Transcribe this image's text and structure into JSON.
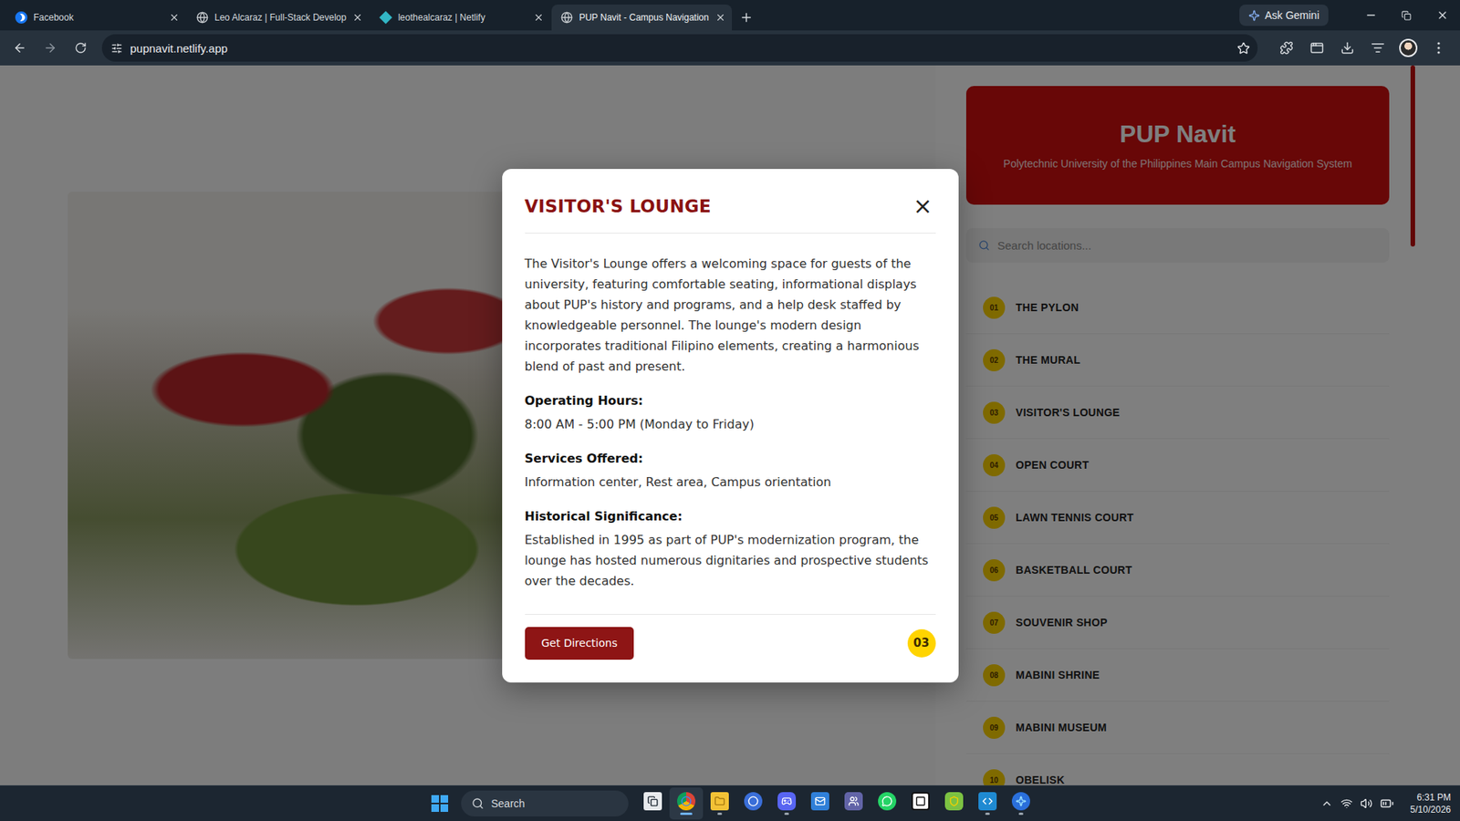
{
  "browser": {
    "tabs": [
      {
        "label": "Facebook",
        "selected": false,
        "kind": "facebook"
      },
      {
        "label": "Leo Alcaraz | Full-Stack Develop",
        "selected": false,
        "kind": "globe"
      },
      {
        "label": "leothealcaraz | Netlify",
        "selected": false,
        "kind": "netlify"
      },
      {
        "label": "PUP Navit - Campus Navigation",
        "selected": true,
        "kind": "globe"
      }
    ],
    "gemini": "Ask Gemini",
    "url": "pupnavit.netlify.app"
  },
  "sidebar": {
    "title": "PUP Navit",
    "subtitle": "Polytechnic University of the Philippines Main Campus Navigation System",
    "search": {
      "placeholder": "Search locations..."
    },
    "items": [
      {
        "number": "01",
        "name": "THE PYLON"
      },
      {
        "number": "02",
        "name": "THE MURAL"
      },
      {
        "number": "03",
        "name": "VISITOR'S LOUNGE"
      },
      {
        "number": "04",
        "name": "OPEN COURT"
      },
      {
        "number": "05",
        "name": "LAWN TENNIS COURT"
      },
      {
        "number": "06",
        "name": "BASKETBALL COURT"
      },
      {
        "number": "07",
        "name": "SOUVENIR SHOP"
      },
      {
        "number": "08",
        "name": "MABINI SHRINE"
      },
      {
        "number": "09",
        "name": "MABINI MUSEUM"
      },
      {
        "number": "10",
        "name": "OBELISK"
      }
    ]
  },
  "modal": {
    "title": "VISITOR'S LOUNGE",
    "close": "×",
    "description": "The Visitor's Lounge offers a welcoming space for guests of the university, featuring comfortable seating, informational displays about PUP's history and programs, and a help desk staffed by knowledgeable personnel. The lounge's modern design incorporates traditional Filipino elements, creating a harmonious blend of past and present.",
    "sections": [
      {
        "heading": "Operating Hours:",
        "text": "8:00 AM - 5:00 PM (Monday to Friday)"
      },
      {
        "heading": "Services Offered:",
        "text": "Information center, Rest area, Campus orientation"
      },
      {
        "heading": "Historical Significance:",
        "text": "Established in 1995 as part of PUP's modernization program, the lounge has hosted numerous dignitaries and prospective students over the decades."
      }
    ],
    "button": "Get Directions",
    "badge": "03"
  },
  "taskbar": {
    "search": "Search",
    "apps": [
      {
        "kind": "taskview",
        "running": false,
        "active": false
      },
      {
        "kind": "chrome",
        "running": true,
        "active": true
      },
      {
        "kind": "explorer",
        "running": true,
        "active": false
      },
      {
        "kind": "wordpress",
        "running": false,
        "active": false
      },
      {
        "kind": "discord",
        "running": true,
        "active": false
      },
      {
        "kind": "mail",
        "running": false,
        "active": false
      },
      {
        "kind": "teams",
        "running": false,
        "active": false
      },
      {
        "kind": "whatsapp",
        "running": false,
        "active": false
      },
      {
        "kind": "notion",
        "running": false,
        "active": false
      },
      {
        "kind": "vpn",
        "running": false,
        "active": false
      },
      {
        "kind": "vscode",
        "running": true,
        "active": false
      },
      {
        "kind": "copilot",
        "running": true,
        "active": false
      }
    ],
    "time": "6:31 PM",
    "date": "5/10/2026"
  }
}
